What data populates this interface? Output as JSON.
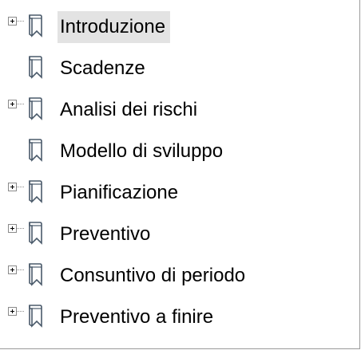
{
  "tree": {
    "items": [
      {
        "label": "Introduzione",
        "expandable": true,
        "selected": true
      },
      {
        "label": "Scadenze",
        "expandable": false,
        "selected": false
      },
      {
        "label": "Analisi dei rischi",
        "expandable": true,
        "selected": false
      },
      {
        "label": "Modello di sviluppo",
        "expandable": false,
        "selected": false
      },
      {
        "label": "Pianificazione",
        "expandable": true,
        "selected": false
      },
      {
        "label": "Preventivo",
        "expandable": true,
        "selected": false
      },
      {
        "label": "Consuntivo di periodo",
        "expandable": true,
        "selected": false
      },
      {
        "label": "Preventivo a finire",
        "expandable": true,
        "selected": false
      }
    ],
    "icon": "bookmark-page-icon",
    "expander_icon": "plus-expander-icon"
  }
}
